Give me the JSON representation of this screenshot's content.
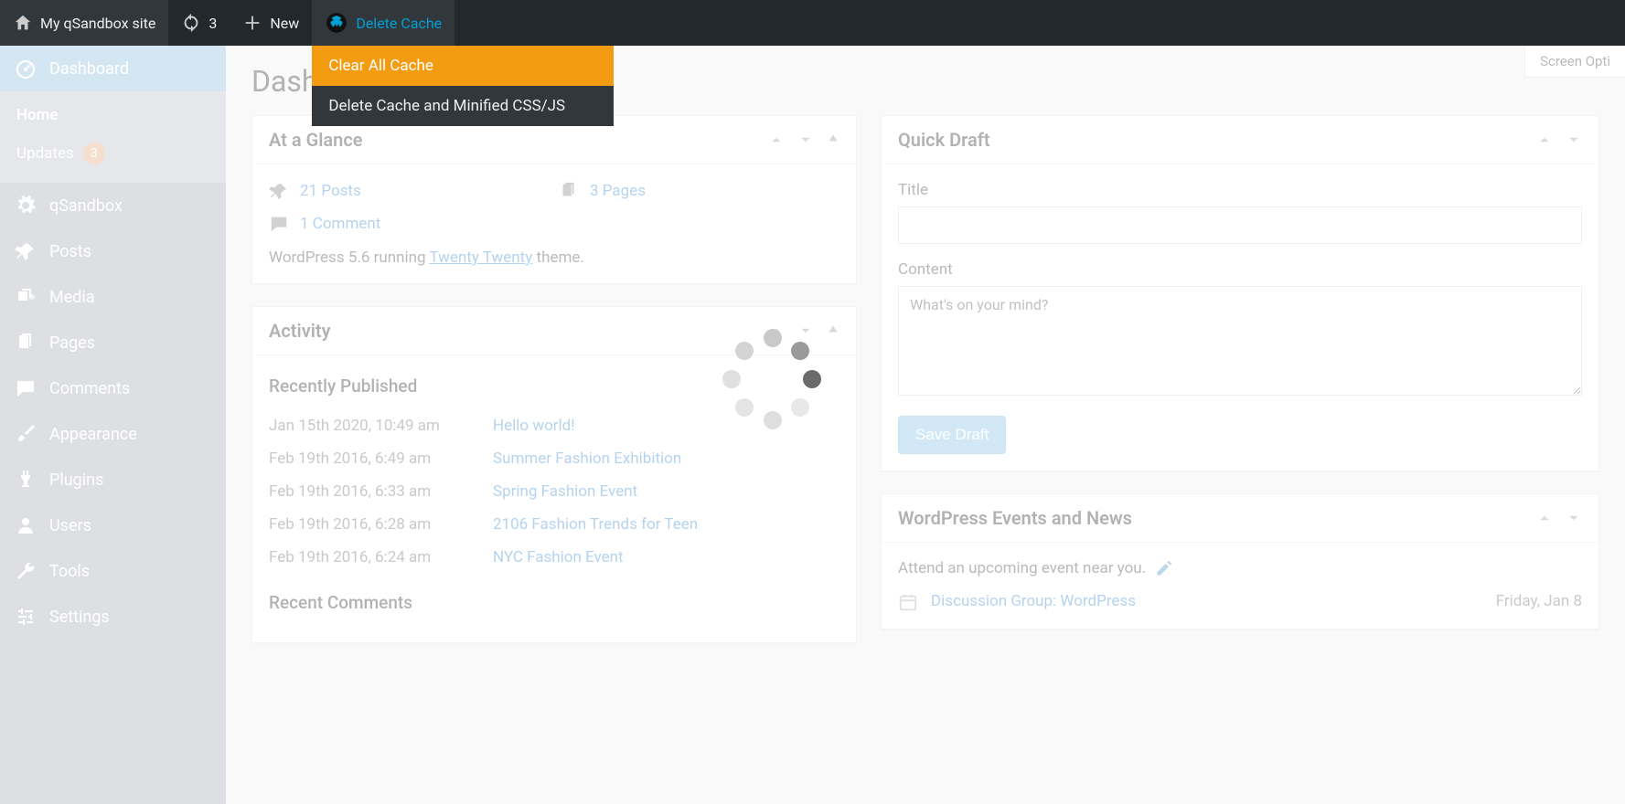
{
  "adminbar": {
    "site_name": "My qSandbox site",
    "updates_count": "3",
    "new_label": "New",
    "delete_cache_label": "Delete Cache",
    "submenu": [
      "Clear All Cache",
      "Delete Cache and Minified CSS/JS"
    ]
  },
  "screen_options": "Screen Opti",
  "sidebar": {
    "dashboard": "Dashboard",
    "home": "Home",
    "updates": "Updates",
    "updates_badge": "3",
    "qsandbox": "qSandbox",
    "posts": "Posts",
    "media": "Media",
    "pages": "Pages",
    "comments": "Comments",
    "appearance": "Appearance",
    "plugins": "Plugins",
    "users": "Users",
    "tools": "Tools",
    "settings": "Settings"
  },
  "content": {
    "heading": "Dashbo",
    "at_a_glance": {
      "title": "At a Glance",
      "posts": "21 Posts",
      "pages": "3 Pages",
      "comments": "1 Comment",
      "version_pre": "WordPress 5.6 running ",
      "theme": "Twenty Twenty",
      "version_post": " theme."
    },
    "activity": {
      "title": "Activity",
      "recently_published": "Recently Published",
      "posts": [
        {
          "date": "Jan 15th 2020, 10:49 am",
          "title": "Hello world!"
        },
        {
          "date": "Feb 19th 2016, 6:49 am",
          "title": "Summer Fashion Exhibition"
        },
        {
          "date": "Feb 19th 2016, 6:33 am",
          "title": "Spring Fashion Event"
        },
        {
          "date": "Feb 19th 2016, 6:28 am",
          "title": "2106 Fashion Trends for Teen"
        },
        {
          "date": "Feb 19th 2016, 6:24 am",
          "title": "NYC Fashion Event"
        }
      ],
      "recent_comments": "Recent Comments"
    },
    "quick_draft": {
      "title": "Quick Draft",
      "title_label": "Title",
      "content_label": "Content",
      "placeholder": "What's on your mind?",
      "button": "Save Draft"
    },
    "events": {
      "title": "WordPress Events and News",
      "note": "Attend an upcoming event near you.",
      "event_title": "Discussion Group: WordPress",
      "event_date": "Friday, Jan 8"
    }
  }
}
